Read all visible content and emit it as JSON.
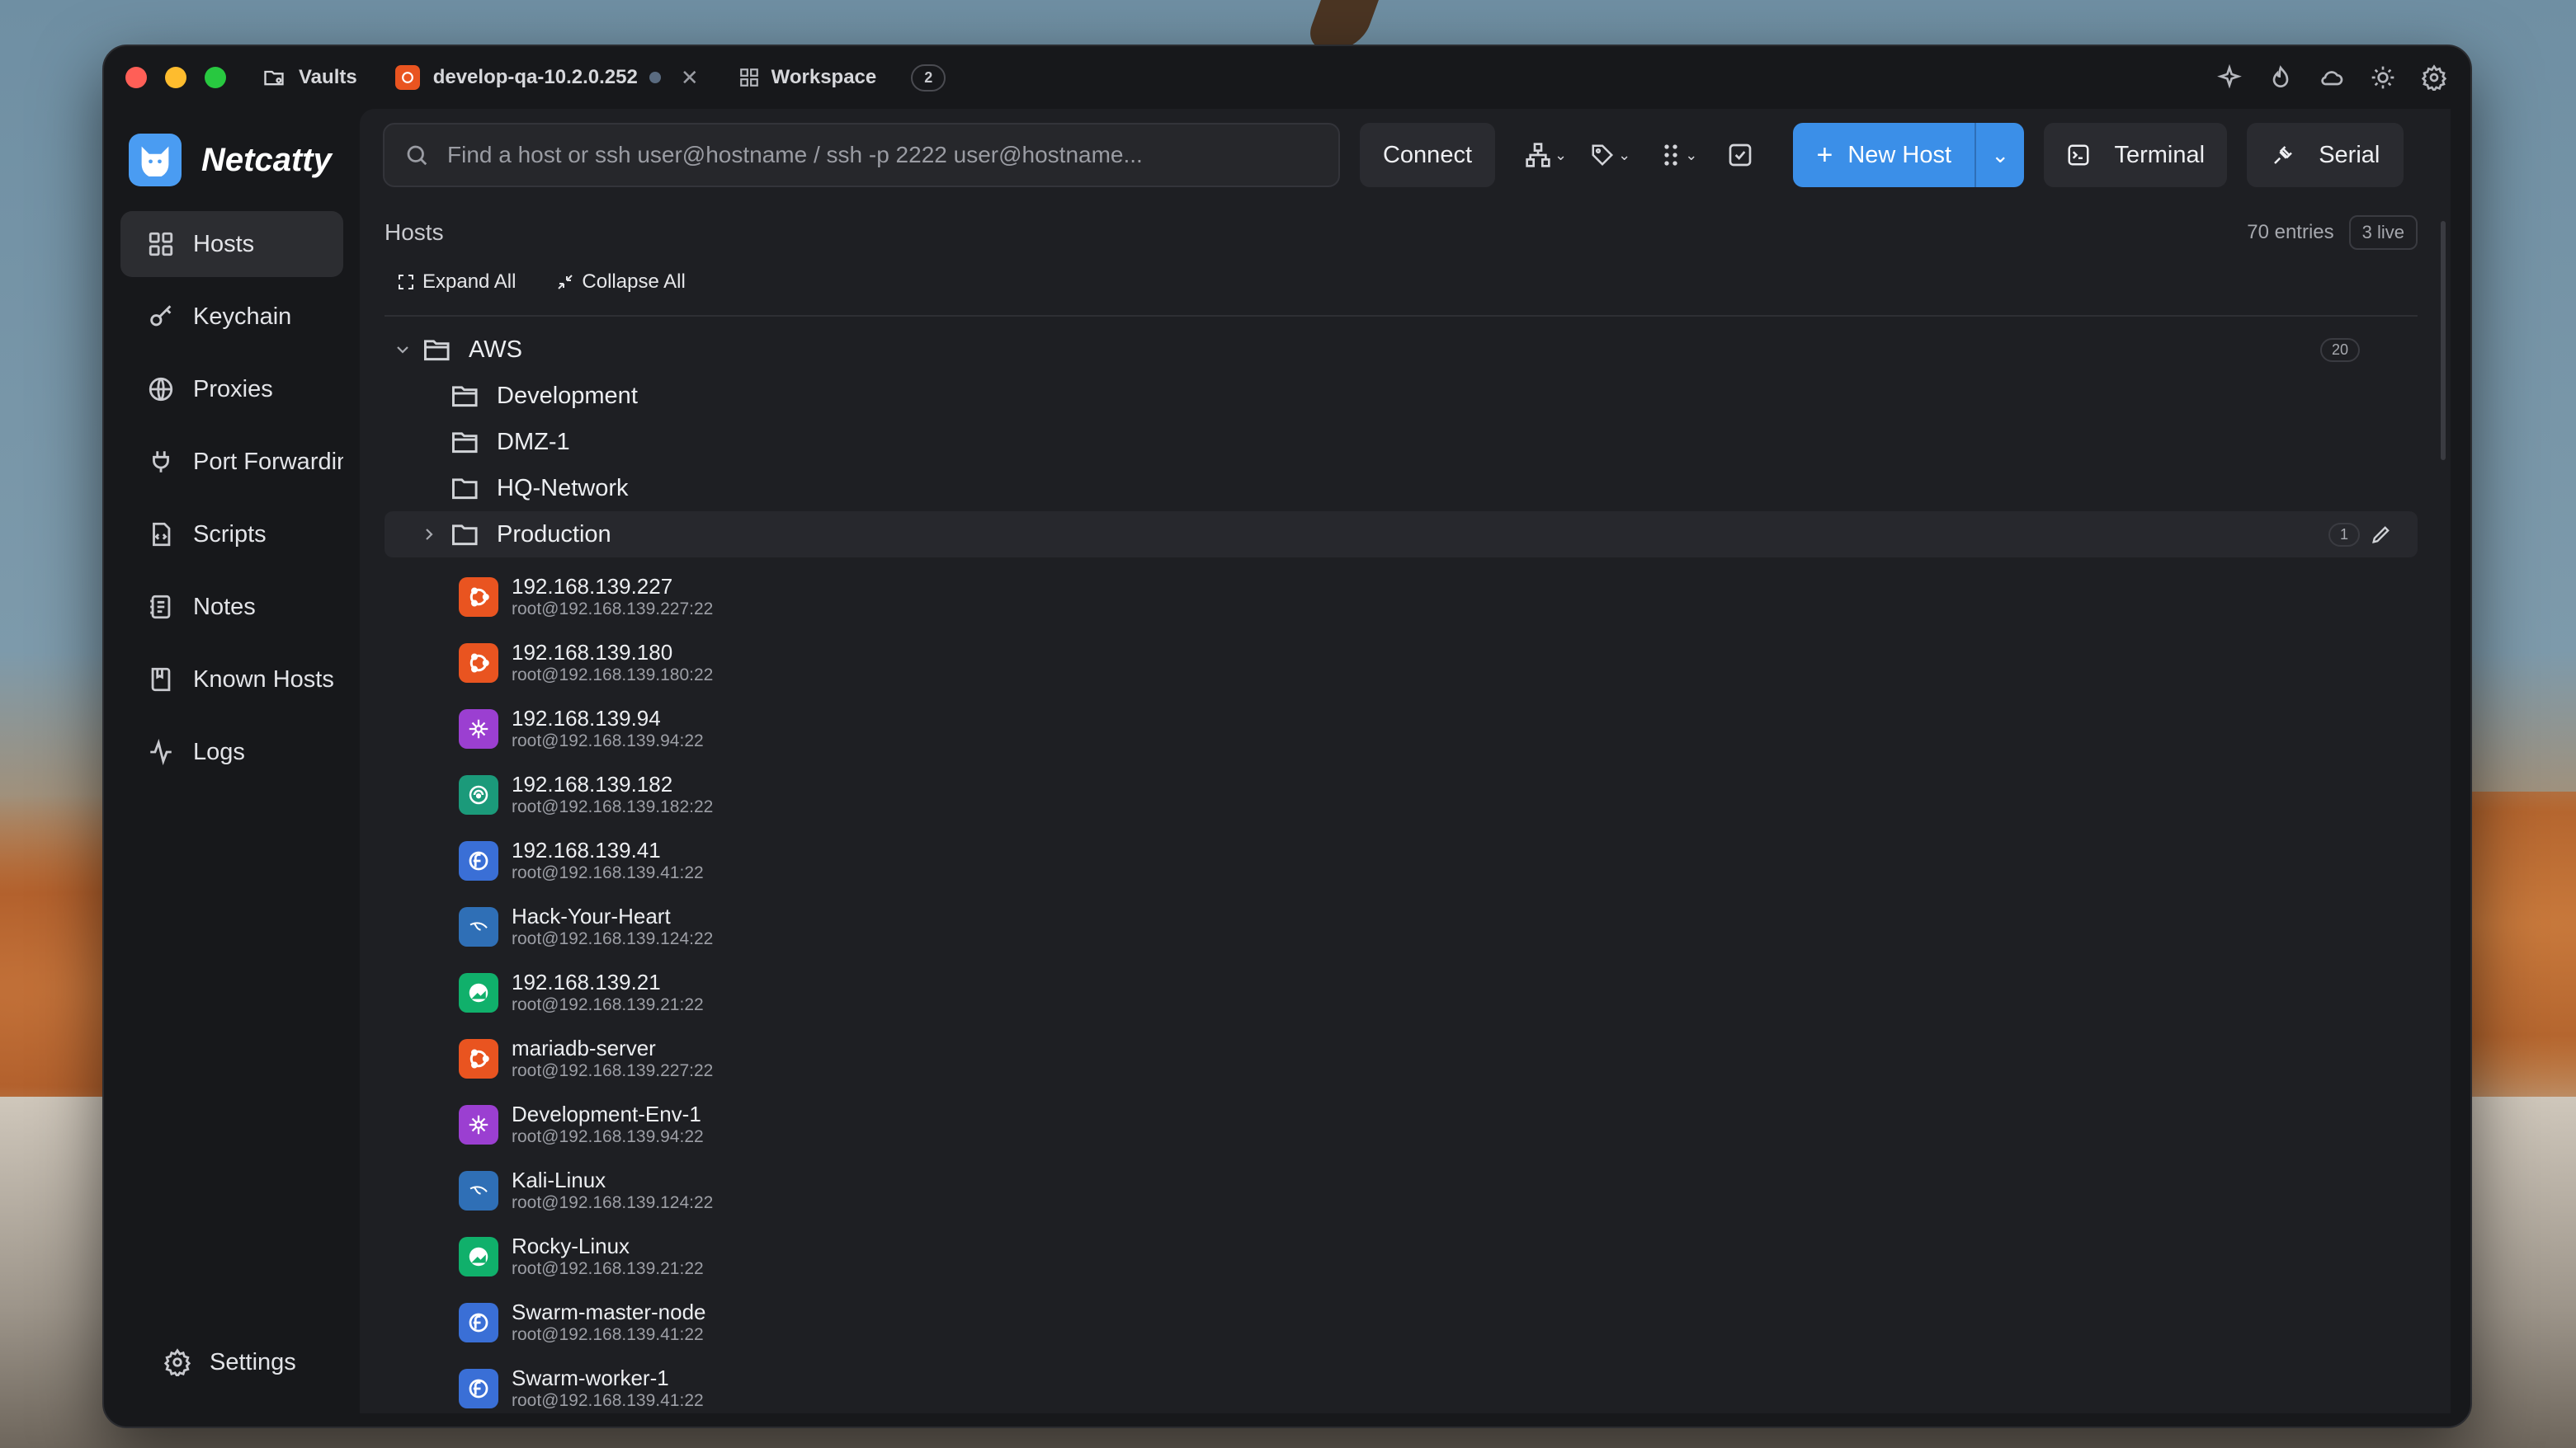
{
  "titlebar": {
    "vaults_label": "Vaults",
    "session_tab_label": "develop-qa-10.2.0.252",
    "workspace_label": "Workspace",
    "workspace_count": "2"
  },
  "brand": {
    "name": "Netcatty"
  },
  "sidebar": {
    "items": [
      {
        "label": "Hosts",
        "icon": "grid-icon"
      },
      {
        "label": "Keychain",
        "icon": "key-icon"
      },
      {
        "label": "Proxies",
        "icon": "globe-icon"
      },
      {
        "label": "Port Forwarding",
        "icon": "plug-icon"
      },
      {
        "label": "Scripts",
        "icon": "script-icon"
      },
      {
        "label": "Notes",
        "icon": "notes-icon"
      },
      {
        "label": "Known Hosts",
        "icon": "book-icon"
      },
      {
        "label": "Logs",
        "icon": "activity-icon"
      }
    ],
    "settings_label": "Settings"
  },
  "toolbar": {
    "search_placeholder": "Find a host or ssh user@hostname / ssh -p 2222 user@hostname...",
    "connect_label": "Connect",
    "new_host_label": "New Host",
    "terminal_label": "Terminal",
    "serial_label": "Serial"
  },
  "hosts": {
    "title": "Hosts",
    "entries": "70 entries",
    "live": "3 live",
    "expand_all": "Expand All",
    "collapse_all": "Collapse All",
    "root_folder": {
      "name": "AWS",
      "count": "20"
    },
    "subfolders": [
      "Development",
      "DMZ-1",
      "HQ-Network"
    ],
    "production": {
      "name": "Production",
      "count": "1"
    },
    "list": [
      {
        "name": "192.168.139.227",
        "addr": "root@192.168.139.227:22",
        "os": "ubuntu",
        "color": "#e95420"
      },
      {
        "name": "192.168.139.180",
        "addr": "root@192.168.139.180:22",
        "os": "ubuntu",
        "color": "#e95420"
      },
      {
        "name": "192.168.139.94",
        "addr": "root@192.168.139.94:22",
        "os": "arch-like",
        "color": "#9b3fd1"
      },
      {
        "name": "192.168.139.182",
        "addr": "root@192.168.139.182:22",
        "os": "opensuse",
        "color": "#1b9a7a"
      },
      {
        "name": "192.168.139.41",
        "addr": "root@192.168.139.41:22",
        "os": "fedora",
        "color": "#3a6fd6"
      },
      {
        "name": "Hack-Your-Heart",
        "addr": "root@192.168.139.124:22",
        "os": "kali",
        "color": "#2f6fb6"
      },
      {
        "name": "192.168.139.21",
        "addr": "root@192.168.139.21:22",
        "os": "rocky",
        "color": "#10b06b"
      },
      {
        "name": "mariadb-server",
        "addr": "root@192.168.139.227:22",
        "os": "ubuntu",
        "color": "#e95420"
      },
      {
        "name": "Development-Env-1",
        "addr": "root@192.168.139.94:22",
        "os": "arch-like",
        "color": "#9b3fd1"
      },
      {
        "name": "Kali-Linux",
        "addr": "root@192.168.139.124:22",
        "os": "kali",
        "color": "#2f6fb6"
      },
      {
        "name": "Rocky-Linux",
        "addr": "root@192.168.139.21:22",
        "os": "rocky",
        "color": "#10b06b"
      },
      {
        "name": "Swarm-master-node",
        "addr": "root@192.168.139.41:22",
        "os": "fedora",
        "color": "#3a6fd6"
      },
      {
        "name": "Swarm-worker-1",
        "addr": "root@192.168.139.41:22",
        "os": "fedora",
        "color": "#3a6fd6"
      }
    ]
  },
  "colors": {
    "accent": "#3b8fe8",
    "window_bg": "#17181b",
    "panel_bg": "#1e1f23"
  }
}
